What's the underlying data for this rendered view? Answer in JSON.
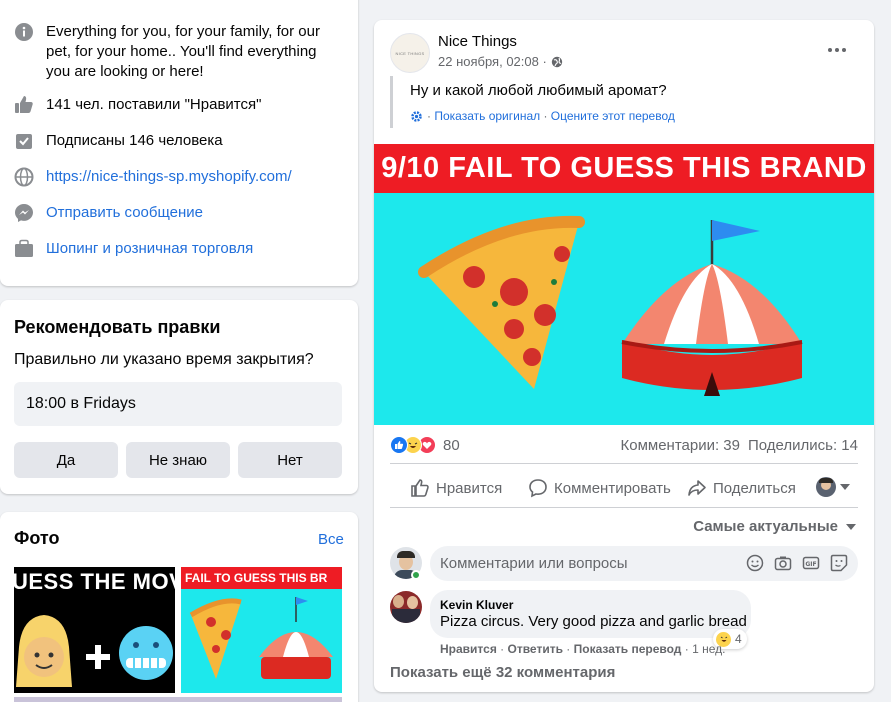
{
  "about": {
    "description": "Everything for you, for your family, for our pet, for your home.. You'll find everything you are looking or here!",
    "likes": "141 чел. поставили \"Нравится\"",
    "followers": "Подписаны 146 человека",
    "website": "https://nice-things-sp.myshopify.com/",
    "message": "Отправить сообщение",
    "category": "Шопинг и розничная торговля"
  },
  "suggest": {
    "title": "Рекомендовать правки",
    "question": "Правильно ли указано время закрытия?",
    "time_value": "18:00 в Fridays",
    "yes": "Да",
    "dont_know": "Не знаю",
    "no": "Нет"
  },
  "photos": {
    "title": "Фото",
    "all_link": "Все",
    "thumb1_text": "UESS THE MOV",
    "thumb2_text": "FAIL TO GUESS THIS BR"
  },
  "post": {
    "page_name": "Nice Things",
    "logo_text": "NICE THINGS",
    "date": "22 ноября, 02:08 ·",
    "text": "Ну и какой любой любимый аромат?",
    "show_original": "Показать оригинал",
    "rate_translation": "Оцените этот перевод",
    "banner": "9/10 FAIL TO GUESS THIS BRAND",
    "reactions_count": "80",
    "comments_count": "Комментарии: 39",
    "shares_count": "Поделились: 14",
    "like": "Нравится",
    "comment": "Комментировать",
    "share": "Поделиться",
    "sort": "Самые актуальные",
    "comment_placeholder": "Комментарии или вопросы",
    "comment_author": "Kevin Kluver",
    "comment_text": "Pizza circus. Very good pizza and garlic bread",
    "comment_reaction_count": "4",
    "comment_like": "Нравится",
    "comment_reply": "Ответить",
    "comment_translation": "Показать перевод",
    "comment_time": "1 нед.",
    "more_comments": "Показать ещё 32 комментария"
  },
  "colors": {
    "link": "#216fdb",
    "banner_red": "#ee1c24",
    "image_cyan": "#1de8ec",
    "like_blue": "#1877f2"
  }
}
